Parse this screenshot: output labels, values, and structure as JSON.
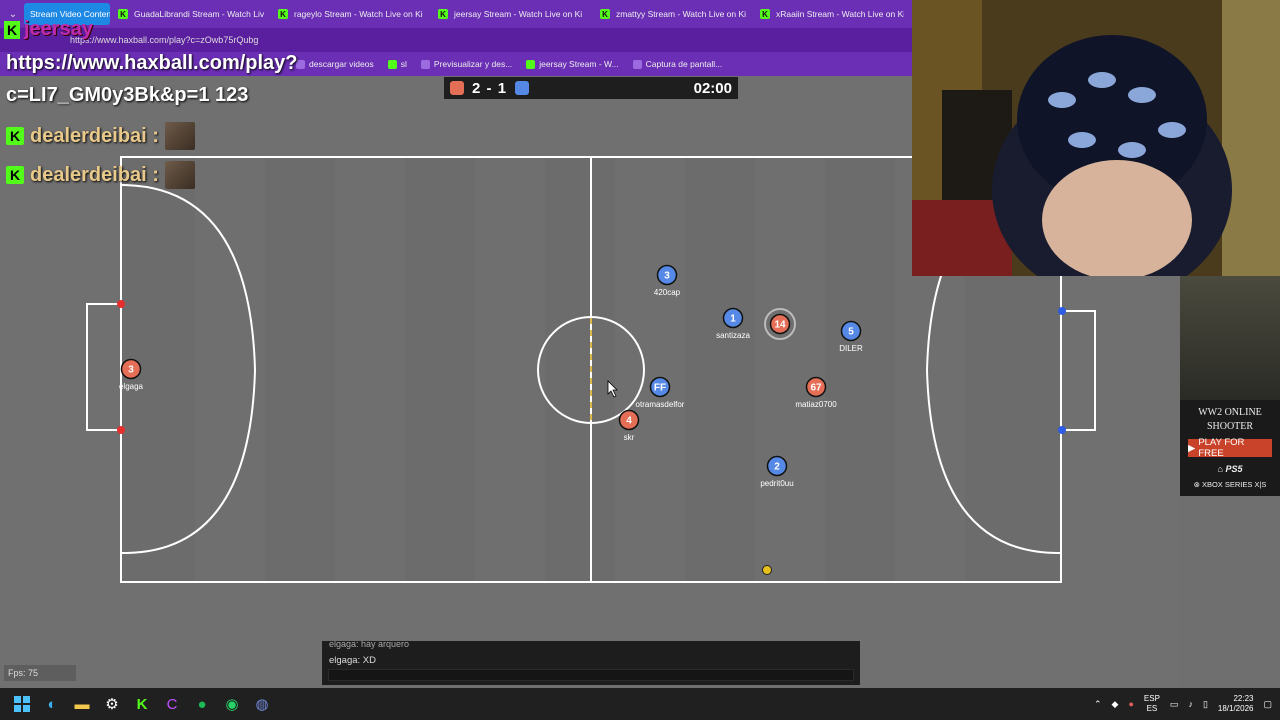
{
  "browser": {
    "tabs": [
      {
        "label": "Stream Video Content",
        "active": true
      },
      {
        "label": "GuadaLibrandi Stream - Watch Liv"
      },
      {
        "label": "rageylo Stream - Watch Live on Ki"
      },
      {
        "label": "jeersay Stream - Watch Live on Ki"
      },
      {
        "label": "zmattyy Stream - Watch Live on Ki"
      },
      {
        "label": "xRaaiin Stream - Watch Live on Ki"
      }
    ],
    "address": "https://www.haxball.com/play?c=zOwb75rQubg",
    "bookmarks": [
      "descargar videos",
      "sl",
      "Previsualizar y des...",
      "jeersay Stream - W...",
      "Captura de pantall..."
    ]
  },
  "overlay": {
    "channel": "jeersay",
    "url_line": "https://www.haxball.com/play?",
    "room_line": "c=LI7_GM0y3Bk&p=1 123",
    "chat": [
      {
        "user": "dealerdeibai :"
      },
      {
        "user": "dealerdeibai :"
      }
    ]
  },
  "scoreboard": {
    "red_score": "2",
    "separator": "-",
    "blue_score": "1",
    "time": "02:00",
    "colors": {
      "red": "#e56e56",
      "blue": "#5689e5"
    }
  },
  "players": [
    {
      "team": "red",
      "number": "3",
      "name": "elgaga"
    },
    {
      "team": "blue",
      "number": "3",
      "name": "420cap"
    },
    {
      "team": "blue",
      "number": "1",
      "name": "santizaza"
    },
    {
      "team": "red",
      "number": "14",
      "name": ""
    },
    {
      "team": "blue",
      "number": "5",
      "name": "DILER"
    },
    {
      "team": "blue",
      "number": "FF",
      "name": "otramasdelfor"
    },
    {
      "team": "red",
      "number": "67",
      "name": "matiaz0700"
    },
    {
      "team": "red",
      "number": "4",
      "name": "skr"
    },
    {
      "team": "blue",
      "number": "2",
      "name": "pedrit0uu"
    }
  ],
  "ad": {
    "title_line1": "WW2 ONLINE",
    "title_line2": "SHOOTER",
    "cta": "PLAY FOR FREE",
    "platform1": "PS5",
    "platform2": "XBOX SERIES X|S"
  },
  "chat": {
    "prev_message": "elgaga: hay arquero",
    "last_message": "elgaga: XD"
  },
  "fps": "Fps: 75",
  "taskbar": {
    "lang_top": "ESP",
    "lang_bottom": "ES",
    "time": "22:23",
    "date": "18/1/2026"
  }
}
